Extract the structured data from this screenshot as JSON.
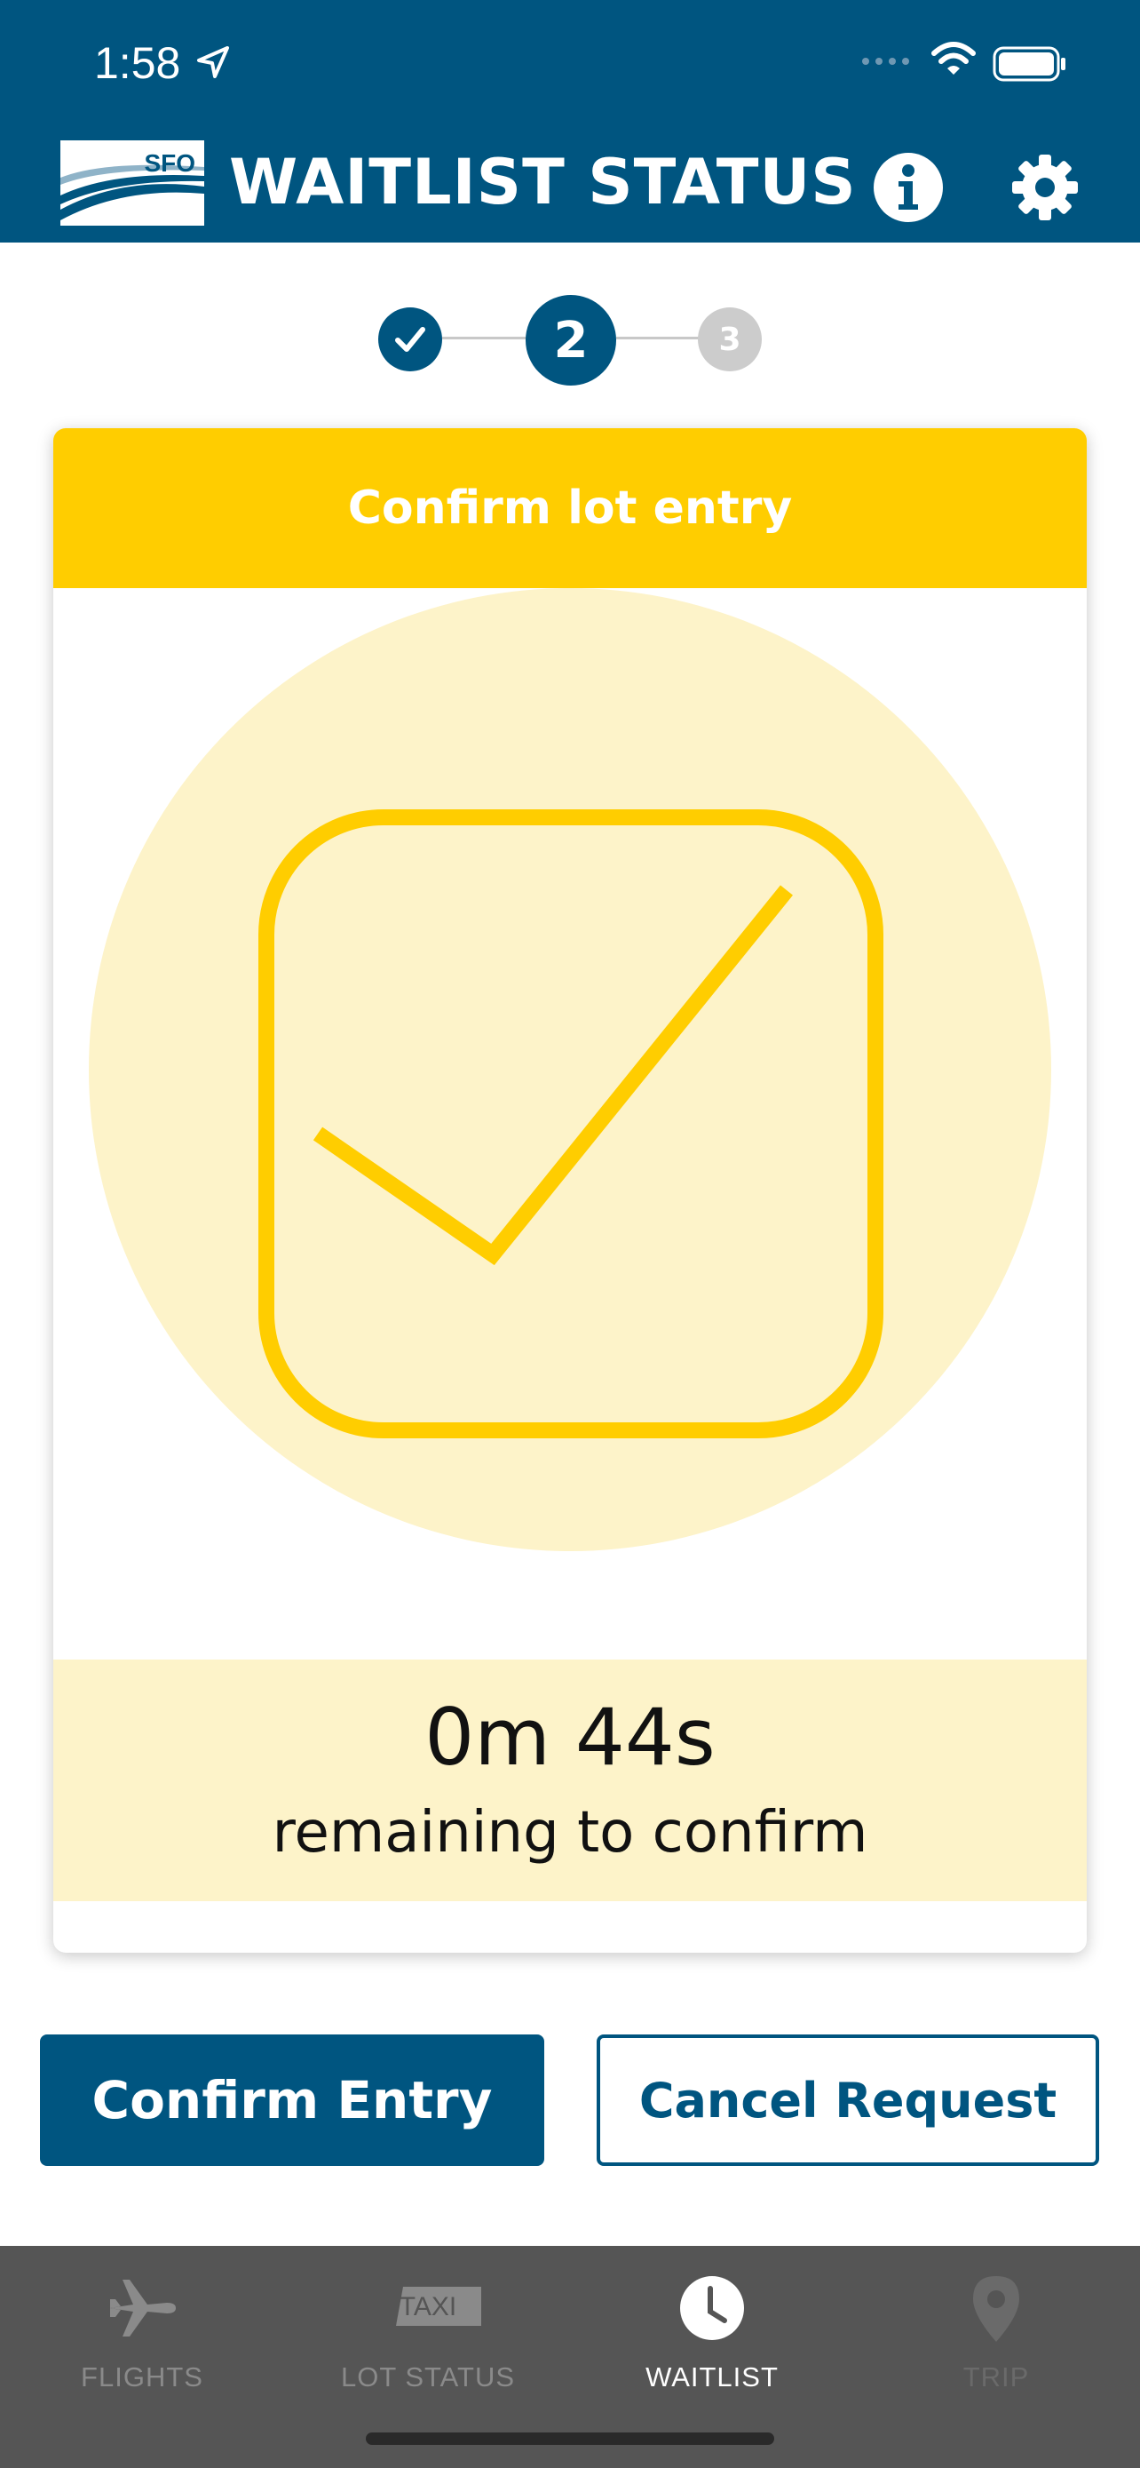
{
  "status_bar": {
    "time": "1:58"
  },
  "header": {
    "logo_text": "SFO",
    "title": "WAITLIST STATUS",
    "info_icon": "info-icon",
    "settings_icon": "gear-icon"
  },
  "stepper": {
    "steps": [
      {
        "label": "",
        "state": "complete"
      },
      {
        "label": "2",
        "state": "current"
      },
      {
        "label": "3",
        "state": "upcoming"
      }
    ]
  },
  "card": {
    "title": "Confirm lot entry",
    "timer": "0m 44s",
    "timer_caption": "remaining to confirm"
  },
  "actions": {
    "confirm_label": "Confirm Entry",
    "cancel_label": "Cancel Request"
  },
  "bottom_nav": {
    "items": [
      {
        "label": "FLIGHTS",
        "icon": "airplane-icon"
      },
      {
        "label": "LOT STATUS",
        "icon": "taxi-icon",
        "icon_text": "TAXI"
      },
      {
        "label": "WAITLIST",
        "icon": "clock-icon",
        "active": true
      },
      {
        "label": "TRIP",
        "icon": "map-pin-icon",
        "disabled": true
      }
    ]
  },
  "colors": {
    "brand_blue": "#005580",
    "accent_yellow": "#ffcd00",
    "light_yellow": "#fdf3c9"
  }
}
